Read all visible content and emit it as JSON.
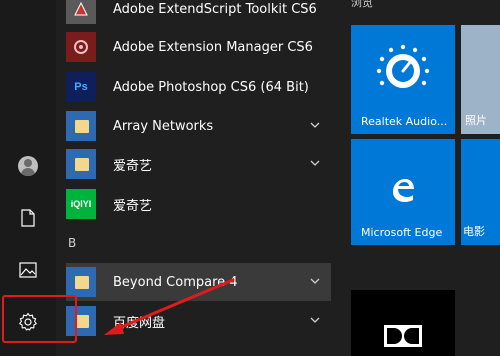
{
  "apps": [
    {
      "label": "Adobe ExtendScript Toolkit CS6",
      "icon": "extendscript-icon"
    },
    {
      "label": "Adobe Extension Manager CS6",
      "icon": "extension-manager-icon"
    },
    {
      "label": "Adobe Photoshop CS6 (64 Bit)",
      "icon": "photoshop-icon",
      "icon_text": "Ps"
    },
    {
      "label": "Array Networks",
      "icon": "folder-icon"
    },
    {
      "label": "爱奇艺",
      "icon": "folder-icon"
    },
    {
      "label": "爱奇艺",
      "icon": "iqiyi-icon",
      "icon_text": "iQIYI"
    },
    {
      "label": "Beyond Compare 4",
      "icon": "folder-icon"
    },
    {
      "label": "百度网盘",
      "icon": "folder-icon"
    }
  ],
  "section_letter": "B",
  "tile_group_title": "浏览",
  "tiles": {
    "realtek": {
      "label": "Realtek Audio..."
    },
    "photos": {
      "label": "照片"
    },
    "edge": {
      "label": "Microsoft Edge"
    },
    "movies": {
      "label": "电影"
    }
  },
  "colors": {
    "tile_blue": "#0078d7",
    "annotation_red": "#e11b1b",
    "selected_row": "#3a3a3a"
  },
  "rail_icons": [
    "user-avatar",
    "document-icon",
    "pictures-icon",
    "settings-icon"
  ]
}
